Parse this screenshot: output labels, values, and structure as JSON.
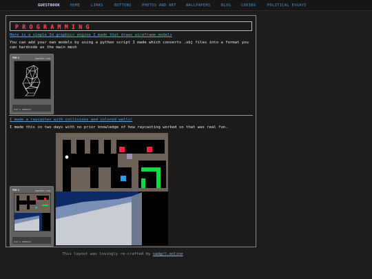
{
  "nav": {
    "items": [
      {
        "label": "GUESTBOOK",
        "active": true
      },
      {
        "label": "HOME"
      },
      {
        "label": "LINKS"
      },
      {
        "label": "BUTTONS"
      },
      {
        "label": "PHOTOS AND ART"
      },
      {
        "label": "WALLPAPERS"
      },
      {
        "label": "BLOG"
      },
      {
        "label": "CODING"
      },
      {
        "label": "POLITICAL ESSAYS"
      }
    ]
  },
  "page": {
    "title": "PROGRAMMING"
  },
  "posts": [
    {
      "link": "Here is a simple 3d graphics engine I made that draws wireframe models",
      "text": "You can add your own models by using a python script I made which converts .obj files into a format you can hardcode as the main mesh"
    },
    {
      "link": "I made a raycaster with collisions and colored walls!",
      "text": "I made this in two days with no prior knowledge of how raycasting worked so that was real fun."
    }
  ],
  "device": {
    "brand": "PGB-2",
    "model": "GRAPHICS CLUB",
    "caption": "PLAY & CONTROLS"
  },
  "raycaster": {
    "colors": {
      "red": "#ff2040",
      "lilac": "#9c8fb3",
      "green": "#00e040",
      "blue": "#2a9df0",
      "wall": "#000000",
      "floor": "#6c6258"
    }
  },
  "footer": {
    "prefix": "This layout was lovingly re-crafted by",
    "link": "sadgrl.online"
  },
  "colors": {
    "background": "#1c1c1c",
    "accent": "#ff4b57",
    "link": "#5aa6ea",
    "nav_link": "#4f91c9"
  }
}
